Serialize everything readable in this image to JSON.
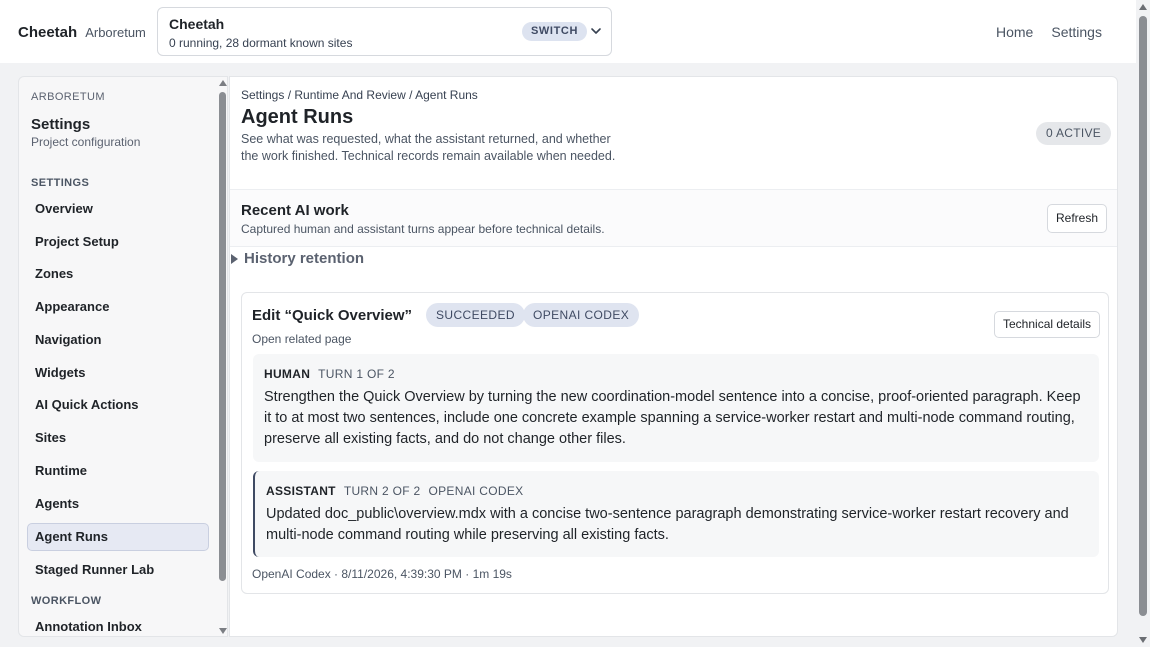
{
  "header": {
    "brand": "Cheetah",
    "brand_sub": "Arboretum",
    "switcher": {
      "title": "Cheetah",
      "subtitle": "0 running, 28 dormant known sites",
      "switch_label": "SWITCH",
      "chevron_icon": "chevron-down-icon"
    },
    "nav": [
      "Home",
      "Settings"
    ]
  },
  "sidebar": {
    "kicker": "ARBORETUM",
    "title": "Settings",
    "subtitle": "Project configuration",
    "section_settings": "SETTINGS",
    "items": [
      {
        "label": "Overview"
      },
      {
        "label": "Project Setup"
      },
      {
        "label": "Zones"
      },
      {
        "label": "Appearance"
      },
      {
        "label": "Navigation"
      },
      {
        "label": "Widgets"
      },
      {
        "label": "AI Quick Actions"
      },
      {
        "label": "Sites"
      },
      {
        "label": "Runtime"
      },
      {
        "label": "Agents"
      },
      {
        "label": "Agent Runs"
      },
      {
        "label": "Staged Runner Lab"
      }
    ],
    "active_item": "Agent Runs",
    "section_workflow": "WORKFLOW",
    "workflow_items": [
      {
        "label": "Annotation Inbox"
      }
    ]
  },
  "main": {
    "breadcrumb": "Settings / Runtime And Review / Agent Runs",
    "title": "Agent Runs",
    "description": "See what was requested, what the assistant returned, and whether the work finished. Technical records remain available when needed.",
    "active_badge": "0 ACTIVE",
    "recent": {
      "title": "Recent AI work",
      "subtitle": "Captured human and assistant turns appear before technical details.",
      "refresh_label": "Refresh"
    },
    "history_label": "History retention",
    "run": {
      "title": "Edit “Quick Overview”",
      "status_badge": "SUCCEEDED",
      "provider_badge": "OPENAI CODEX",
      "link": "Open related page",
      "tech_button": "Technical details",
      "turns": [
        {
          "role": "HUMAN",
          "turn": "TURN 1 OF 2",
          "provider": "",
          "text": "Strengthen the Quick Overview by turning the new coordination-model sentence into a concise, proof-oriented paragraph. Keep it to at most two sentences, include one concrete example spanning a service-worker restart and multi-node command routing, preserve all existing facts, and do not change other files."
        },
        {
          "role": "ASSISTANT",
          "turn": "TURN 2 OF 2",
          "provider": "OPENAI CODEX",
          "text": "Updated doc_public\\overview.mdx with a concise two-sentence paragraph demonstrating service-worker restart recovery and multi-node command routing while preserving all existing facts."
        }
      ],
      "footer": "OpenAI Codex · 8/11/2026, 4:39:30 PM · 1m 19s"
    }
  },
  "colors": {
    "accent": "#3f4a63",
    "badge_bg": "#dfe4f0",
    "active_nav_bg": "#e6e9f3"
  }
}
